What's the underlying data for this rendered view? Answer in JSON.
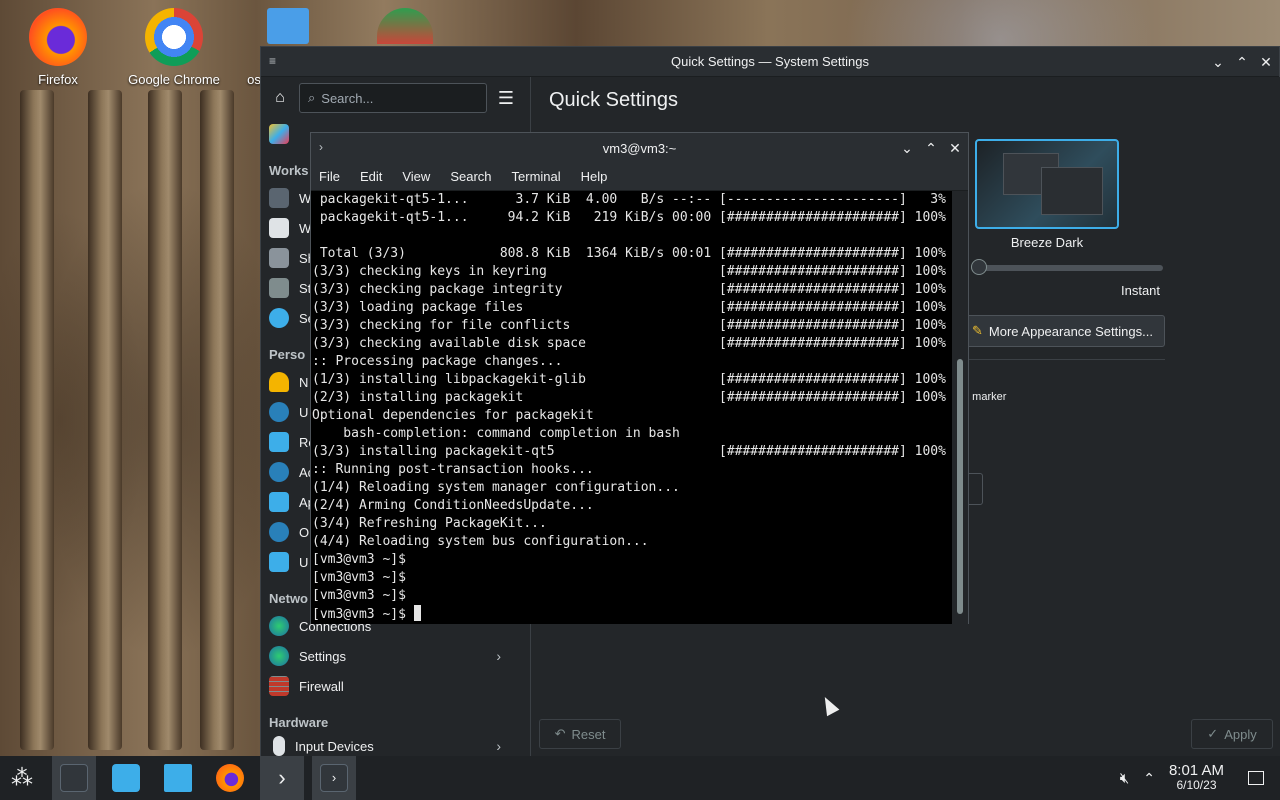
{
  "desktop": {
    "icons": [
      {
        "label": "Firefox",
        "icon": "firefox-icon"
      },
      {
        "label": "Google Chrome",
        "icon": "chrome-icon"
      },
      {
        "label": "os",
        "icon": "file-icon"
      },
      {
        "label": "",
        "icon": "partial-app-icon"
      }
    ]
  },
  "settings": {
    "title": "Quick Settings — System Settings",
    "search_placeholder": "Search...",
    "page_heading": "Quick Settings",
    "sections": {
      "workspace": "Works",
      "personalization": "Perso",
      "network": "Netwo",
      "hardware": "Hardware"
    },
    "sidebar_items": [
      {
        "label": "W",
        "icon": "workspace-behavior-icon"
      },
      {
        "label": "W",
        "icon": "window-management-icon"
      },
      {
        "label": "Sh",
        "icon": "shortcuts-icon"
      },
      {
        "label": "St",
        "icon": "startup-icon"
      },
      {
        "label": "Se",
        "icon": "search-settings-icon"
      },
      {
        "label": "N",
        "icon": "notifications-icon"
      },
      {
        "label": "U",
        "icon": "users-icon"
      },
      {
        "label": "Re",
        "icon": "regional-icon"
      },
      {
        "label": "Ac",
        "icon": "accessibility-icon"
      },
      {
        "label": "Ap",
        "icon": "applications-icon"
      },
      {
        "label": "O",
        "icon": "online-accounts-icon"
      },
      {
        "label": "U",
        "icon": "user-feedback-icon"
      },
      {
        "label": "Connections",
        "icon": "connections-icon"
      },
      {
        "label": "Settings",
        "icon": "network-settings-icon"
      },
      {
        "label": "Firewall",
        "icon": "firewall-icon"
      },
      {
        "label": "Input Devices",
        "icon": "input-devices-icon"
      }
    ],
    "theme_name": "Breeze Dark",
    "animation_label": "Instant",
    "more_appearance_label": "More Appearance Settings...",
    "marker_text": "n marker",
    "reset_label": "Reset",
    "apply_label": "Apply"
  },
  "terminal": {
    "title": "vm3@vm3:~",
    "menu": [
      "File",
      "Edit",
      "View",
      "Search",
      "Terminal",
      "Help"
    ],
    "lines": [
      " packagekit-qt5-1...      3.7 KiB  4.00   B/s --:-- [----------------------]   3%",
      " packagekit-qt5-1...     94.2 KiB   219 KiB/s 00:00 [######################] 100%",
      "",
      " Total (3/3)            808.8 KiB  1364 KiB/s 00:01 [######################] 100%",
      "(3/3) checking keys in keyring                      [######################] 100%",
      "(3/3) checking package integrity                    [######################] 100%",
      "(3/3) loading package files                         [######################] 100%",
      "(3/3) checking for file conflicts                   [######################] 100%",
      "(3/3) checking available disk space                 [######################] 100%",
      ":: Processing package changes...",
      "(1/3) installing libpackagekit-glib                 [######################] 100%",
      "(2/3) installing packagekit                         [######################] 100%",
      "Optional dependencies for packagekit",
      "    bash-completion: command completion in bash",
      "(3/3) installing packagekit-qt5                     [######################] 100%",
      ":: Running post-transaction hooks...",
      "(1/4) Reloading system manager configuration...",
      "(2/4) Arming ConditionNeedsUpdate...",
      "(3/4) Refreshing PackageKit...",
      "(4/4) Reloading system bus configuration...",
      "[vm3@vm3 ~]$",
      "[vm3@vm3 ~]$",
      "[vm3@vm3 ~]$",
      "[vm3@vm3 ~]$ "
    ]
  },
  "taskbar": {
    "apps": [
      {
        "icon": "app-launcher-icon",
        "active": false
      },
      {
        "icon": "system-settings-icon",
        "active": true
      },
      {
        "icon": "discover-store-icon",
        "active": false
      },
      {
        "icon": "file-manager-icon",
        "active": false
      },
      {
        "icon": "firefox-icon",
        "active": false
      },
      {
        "icon": "kde-connect-icon",
        "active": true
      },
      {
        "icon": "konsole-icon",
        "active": true
      }
    ],
    "clock_time": "8:01 AM",
    "clock_date": "6/10/23"
  },
  "colors": {
    "accent": "#3daee9",
    "window_bg": "#232629",
    "titlebar_bg": "#2a2e32",
    "terminal_bg": "#000000",
    "terminal_fg": "#e6e6e6"
  }
}
